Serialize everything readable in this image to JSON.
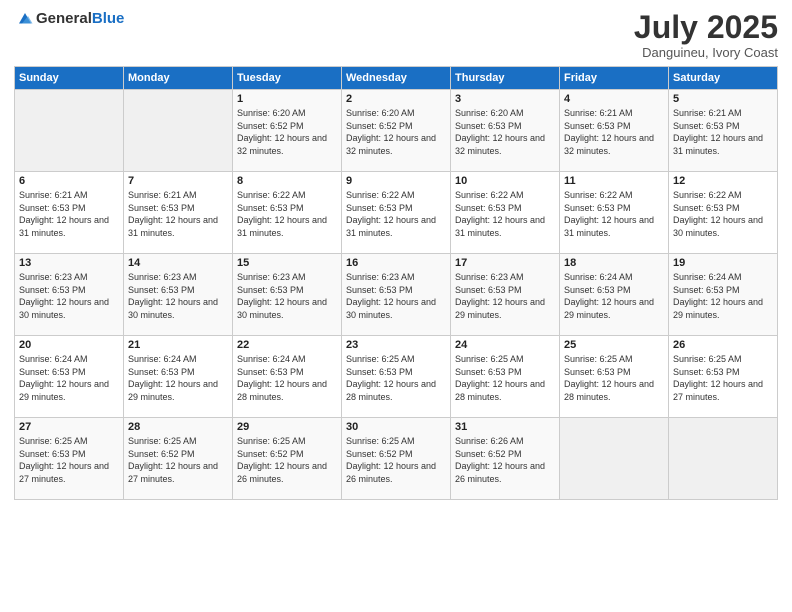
{
  "header": {
    "logo_general": "General",
    "logo_blue": "Blue",
    "title": "July 2025",
    "subtitle": "Danguineu, Ivory Coast"
  },
  "weekdays": [
    "Sunday",
    "Monday",
    "Tuesday",
    "Wednesday",
    "Thursday",
    "Friday",
    "Saturday"
  ],
  "weeks": [
    [
      {
        "day": "",
        "sunrise": "",
        "sunset": "",
        "daylight": "",
        "empty": true
      },
      {
        "day": "",
        "sunrise": "",
        "sunset": "",
        "daylight": "",
        "empty": true
      },
      {
        "day": "1",
        "sunrise": "Sunrise: 6:20 AM",
        "sunset": "Sunset: 6:52 PM",
        "daylight": "Daylight: 12 hours and 32 minutes."
      },
      {
        "day": "2",
        "sunrise": "Sunrise: 6:20 AM",
        "sunset": "Sunset: 6:52 PM",
        "daylight": "Daylight: 12 hours and 32 minutes."
      },
      {
        "day": "3",
        "sunrise": "Sunrise: 6:20 AM",
        "sunset": "Sunset: 6:53 PM",
        "daylight": "Daylight: 12 hours and 32 minutes."
      },
      {
        "day": "4",
        "sunrise": "Sunrise: 6:21 AM",
        "sunset": "Sunset: 6:53 PM",
        "daylight": "Daylight: 12 hours and 32 minutes."
      },
      {
        "day": "5",
        "sunrise": "Sunrise: 6:21 AM",
        "sunset": "Sunset: 6:53 PM",
        "daylight": "Daylight: 12 hours and 31 minutes."
      }
    ],
    [
      {
        "day": "6",
        "sunrise": "Sunrise: 6:21 AM",
        "sunset": "Sunset: 6:53 PM",
        "daylight": "Daylight: 12 hours and 31 minutes."
      },
      {
        "day": "7",
        "sunrise": "Sunrise: 6:21 AM",
        "sunset": "Sunset: 6:53 PM",
        "daylight": "Daylight: 12 hours and 31 minutes."
      },
      {
        "day": "8",
        "sunrise": "Sunrise: 6:22 AM",
        "sunset": "Sunset: 6:53 PM",
        "daylight": "Daylight: 12 hours and 31 minutes."
      },
      {
        "day": "9",
        "sunrise": "Sunrise: 6:22 AM",
        "sunset": "Sunset: 6:53 PM",
        "daylight": "Daylight: 12 hours and 31 minutes."
      },
      {
        "day": "10",
        "sunrise": "Sunrise: 6:22 AM",
        "sunset": "Sunset: 6:53 PM",
        "daylight": "Daylight: 12 hours and 31 minutes."
      },
      {
        "day": "11",
        "sunrise": "Sunrise: 6:22 AM",
        "sunset": "Sunset: 6:53 PM",
        "daylight": "Daylight: 12 hours and 31 minutes."
      },
      {
        "day": "12",
        "sunrise": "Sunrise: 6:22 AM",
        "sunset": "Sunset: 6:53 PM",
        "daylight": "Daylight: 12 hours and 30 minutes."
      }
    ],
    [
      {
        "day": "13",
        "sunrise": "Sunrise: 6:23 AM",
        "sunset": "Sunset: 6:53 PM",
        "daylight": "Daylight: 12 hours and 30 minutes."
      },
      {
        "day": "14",
        "sunrise": "Sunrise: 6:23 AM",
        "sunset": "Sunset: 6:53 PM",
        "daylight": "Daylight: 12 hours and 30 minutes."
      },
      {
        "day": "15",
        "sunrise": "Sunrise: 6:23 AM",
        "sunset": "Sunset: 6:53 PM",
        "daylight": "Daylight: 12 hours and 30 minutes."
      },
      {
        "day": "16",
        "sunrise": "Sunrise: 6:23 AM",
        "sunset": "Sunset: 6:53 PM",
        "daylight": "Daylight: 12 hours and 30 minutes."
      },
      {
        "day": "17",
        "sunrise": "Sunrise: 6:23 AM",
        "sunset": "Sunset: 6:53 PM",
        "daylight": "Daylight: 12 hours and 29 minutes."
      },
      {
        "day": "18",
        "sunrise": "Sunrise: 6:24 AM",
        "sunset": "Sunset: 6:53 PM",
        "daylight": "Daylight: 12 hours and 29 minutes."
      },
      {
        "day": "19",
        "sunrise": "Sunrise: 6:24 AM",
        "sunset": "Sunset: 6:53 PM",
        "daylight": "Daylight: 12 hours and 29 minutes."
      }
    ],
    [
      {
        "day": "20",
        "sunrise": "Sunrise: 6:24 AM",
        "sunset": "Sunset: 6:53 PM",
        "daylight": "Daylight: 12 hours and 29 minutes."
      },
      {
        "day": "21",
        "sunrise": "Sunrise: 6:24 AM",
        "sunset": "Sunset: 6:53 PM",
        "daylight": "Daylight: 12 hours and 29 minutes."
      },
      {
        "day": "22",
        "sunrise": "Sunrise: 6:24 AM",
        "sunset": "Sunset: 6:53 PM",
        "daylight": "Daylight: 12 hours and 28 minutes."
      },
      {
        "day": "23",
        "sunrise": "Sunrise: 6:25 AM",
        "sunset": "Sunset: 6:53 PM",
        "daylight": "Daylight: 12 hours and 28 minutes."
      },
      {
        "day": "24",
        "sunrise": "Sunrise: 6:25 AM",
        "sunset": "Sunset: 6:53 PM",
        "daylight": "Daylight: 12 hours and 28 minutes."
      },
      {
        "day": "25",
        "sunrise": "Sunrise: 6:25 AM",
        "sunset": "Sunset: 6:53 PM",
        "daylight": "Daylight: 12 hours and 28 minutes."
      },
      {
        "day": "26",
        "sunrise": "Sunrise: 6:25 AM",
        "sunset": "Sunset: 6:53 PM",
        "daylight": "Daylight: 12 hours and 27 minutes."
      }
    ],
    [
      {
        "day": "27",
        "sunrise": "Sunrise: 6:25 AM",
        "sunset": "Sunset: 6:53 PM",
        "daylight": "Daylight: 12 hours and 27 minutes."
      },
      {
        "day": "28",
        "sunrise": "Sunrise: 6:25 AM",
        "sunset": "Sunset: 6:52 PM",
        "daylight": "Daylight: 12 hours and 27 minutes."
      },
      {
        "day": "29",
        "sunrise": "Sunrise: 6:25 AM",
        "sunset": "Sunset: 6:52 PM",
        "daylight": "Daylight: 12 hours and 26 minutes."
      },
      {
        "day": "30",
        "sunrise": "Sunrise: 6:25 AM",
        "sunset": "Sunset: 6:52 PM",
        "daylight": "Daylight: 12 hours and 26 minutes."
      },
      {
        "day": "31",
        "sunrise": "Sunrise: 6:26 AM",
        "sunset": "Sunset: 6:52 PM",
        "daylight": "Daylight: 12 hours and 26 minutes."
      },
      {
        "day": "",
        "sunrise": "",
        "sunset": "",
        "daylight": "",
        "empty": true
      },
      {
        "day": "",
        "sunrise": "",
        "sunset": "",
        "daylight": "",
        "empty": true
      }
    ]
  ]
}
